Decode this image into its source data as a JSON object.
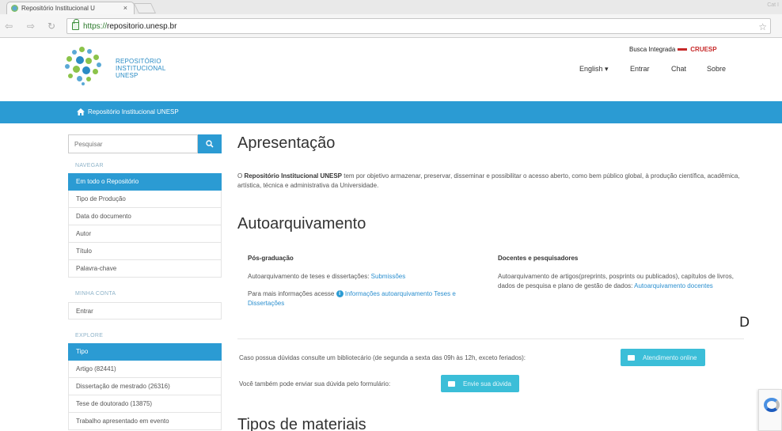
{
  "browser": {
    "tab_title": "Repositório Institucional U",
    "tab_close": "×",
    "corner_text": "Cat I",
    "url_protocol": "https://",
    "url_host": "repositorio.unesp.br"
  },
  "header": {
    "logo_lines": [
      "REPOSITÓRIO",
      "INSTITUCIONAL",
      "UNESP"
    ],
    "busca_label": "Busca Integrada",
    "cruesp": "CRUESP",
    "nav": {
      "language": "English",
      "language_caret": "▾",
      "entrar": "Entrar",
      "chat": "Chat",
      "sobre": "Sobre"
    }
  },
  "breadcrumb": {
    "label": "Repositório Institucional UNESP"
  },
  "sidebar": {
    "search_placeholder": "Pesquisar",
    "navegar_heading": "NAVEGAR",
    "navegar_items": [
      "Em todo o Repositório",
      "Tipo de Produção",
      "Data do documento",
      "Autor",
      "Título",
      "Palavra-chave"
    ],
    "minha_conta_heading": "MINHA CONTA",
    "minha_conta_items": [
      "Entrar"
    ],
    "explore_heading": "EXPLORE",
    "explore_items": [
      "Tipo",
      "Artigo (82441)",
      "Dissertação de mestrado (26316)",
      "Tese de doutorado (13875)",
      "Trabalho apresentado em evento"
    ]
  },
  "main": {
    "apresentacao_title": "Apresentação",
    "apresentacao_bold": "Repositório Institucional UNESP",
    "apresentacao_pre": "O ",
    "apresentacao_rest": " tem por objetivo armazenar, preservar, disseminar e possibilitar o acesso aberto, como bem público global, à produção científica, acadêmica, artística, técnica e administrativa da Universidade.",
    "autoarquivamento_title": "Autoarquivamento",
    "pos": {
      "heading": "Pós-graduação",
      "line1_text": "Autoarquivamento de teses e dissertações: ",
      "line1_link": "Submissões",
      "line2_text": "Para mais informações acesse ",
      "line2_link": "Informações autoarquivamento Teses e Dissertações"
    },
    "docentes": {
      "heading": "Docentes e pesquisadores",
      "text": "Autoarquivamento de artigos(preprints, posprints ou publicados), capítulos de livros, dados de pesquisa e plano de gestão de dados: ",
      "link": "Autoarquivamento docentes"
    },
    "duvidas_text": "Caso possua dúvidas consulte um bibliotecário (de segunda a sexta das 09h às 12h, exceto feriados):",
    "atendimento_button": "Atendimento online",
    "formulario_text": "Você também pode enviar sua dúvida pelo formulário:",
    "envie_button": "Envie sua dúvida",
    "tipos_title": "Tipos de materiais",
    "stray_glyph": "D",
    "info_icon_glyph": "i"
  },
  "colors": {
    "brand_blue": "#2b9bd3",
    "button_cyan": "#3bbed8",
    "link": "#2b8fcf",
    "cruesp_red": "#c62828"
  }
}
